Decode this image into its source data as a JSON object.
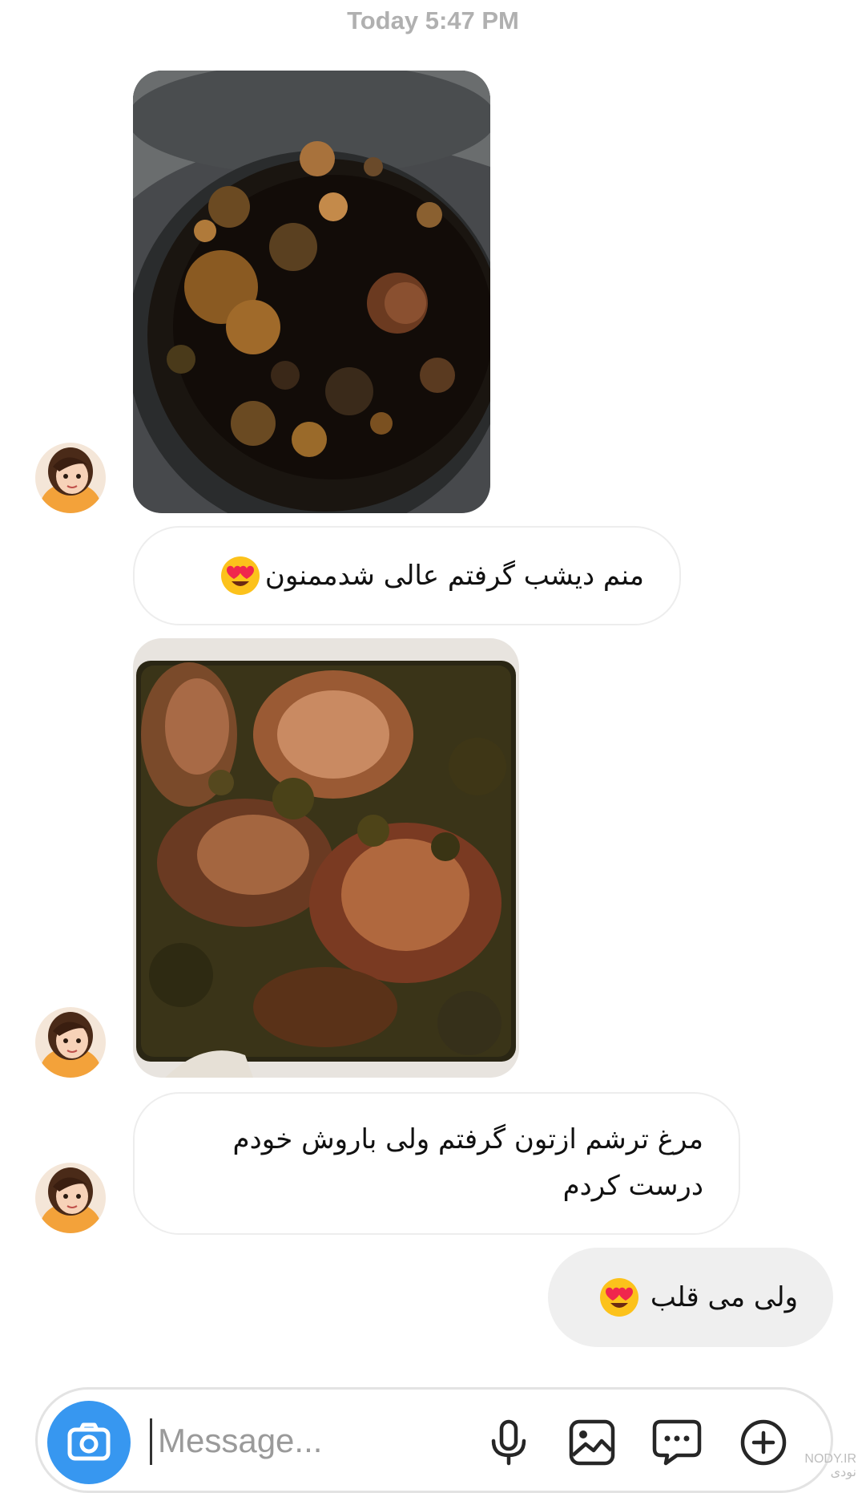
{
  "thread": {
    "timestamp": "Today 5:47 PM"
  },
  "messages": [
    {
      "kind": "photo",
      "sender": "other",
      "subject": "stew in pot"
    },
    {
      "kind": "text",
      "sender": "other",
      "text": "منم دیشب گرفتم عالی شدممنون",
      "emoji": "smiling-face-with-heart-eyes"
    },
    {
      "kind": "photo",
      "sender": "other",
      "subject": "chicken with herb sauce"
    },
    {
      "kind": "text",
      "sender": "other",
      "lines": [
        "مرغ ترشم ازتون گرفتم ولی باروش خودم",
        "درست کردم"
      ]
    },
    {
      "kind": "text",
      "sender": "me",
      "text": "ولی می قلب",
      "emoji": "smiling-face-with-heart-eyes"
    }
  ],
  "composer": {
    "placeholder": "Message...",
    "value": "",
    "buttons": [
      "camera-icon",
      "microphone-icon",
      "gallery-icon",
      "sticker-icon",
      "plus-icon"
    ],
    "accent_color": "#3797f0"
  },
  "watermark": {
    "line1": "NODY.IR",
    "line2": "نودی"
  },
  "colors": {
    "timestamp": "#b0b0b0",
    "outgoing_bubble": "#efefef",
    "incoming_border": "#ededed"
  }
}
